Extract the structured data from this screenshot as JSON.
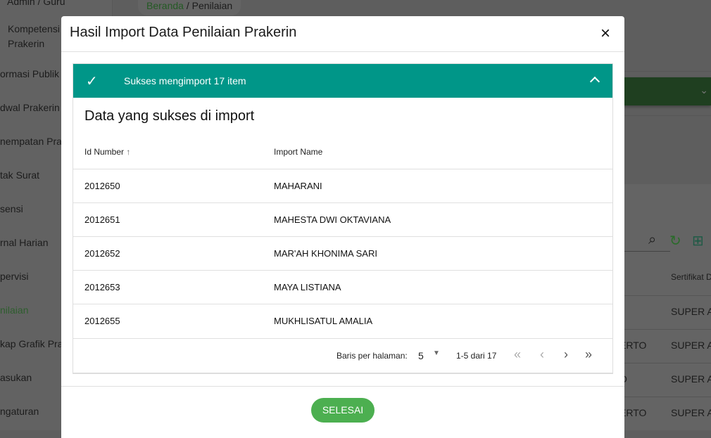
{
  "sidebar": {
    "items": [
      "Admin / Guru",
      "Kompetensi",
      "Prakerin",
      "ormasi Publik",
      "dwal Prakerin",
      "nempatan Pra",
      "tak Surat",
      "sensi",
      "rnal Harian",
      "pervisi",
      "nilaian",
      "kap Grafik Pra",
      "asukan",
      "ngaturan"
    ]
  },
  "breadcrumb": {
    "home": "Beranda",
    "sep": "/",
    "current": "Penilaian"
  },
  "background_table": {
    "header": "Sertifikat D",
    "cells": [
      "SUPER A",
      "SUPER A",
      "SUPER A",
      "SUPER A"
    ],
    "partial": [
      "ERTO",
      "O",
      "ERTO"
    ]
  },
  "modal": {
    "title": "Hasil Import Data Penilaian Prakerin",
    "close": "×",
    "alert": "Sukses mengimport 17 item",
    "section_title": "Data yang sukses di import",
    "columns": [
      "Id Number",
      "Import Name"
    ],
    "rows": [
      [
        "2012650",
        "MAHARANI"
      ],
      [
        "2012651",
        "MAHESTA DWI OKTAVIANA"
      ],
      [
        "2012652",
        "MAR'AH KHONIMA SARI"
      ],
      [
        "2012653",
        "MAYA LISTIANA"
      ],
      [
        "2012655",
        "MUKHLISATUL AMALIA"
      ]
    ],
    "pagination": {
      "rows_label": "Baris per halaman:",
      "rows_value": "5",
      "range": "1-5 dari 17"
    },
    "done": "SELESAI"
  },
  "colors": {
    "alert": "#009688",
    "button": "#4caf50"
  }
}
